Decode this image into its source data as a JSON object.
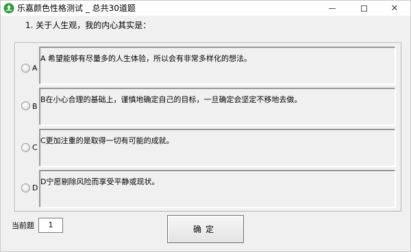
{
  "window": {
    "title": "乐嘉颜色性格测试 _ 总共30道题",
    "close_glyph": "✕"
  },
  "question": {
    "text": "1. 关于人生观，我的内心其实是："
  },
  "options": [
    {
      "letter": "A",
      "text": "A 希望能够有尽量多的人生体验，所以会有非常多样化的想法。"
    },
    {
      "letter": "B",
      "text": "B在小心合理的基础上，谨慎地确定自己的目标，一旦确定会坚定不移地去做。"
    },
    {
      "letter": "C",
      "text": "C更加注重的是取得一切有可能的成就。"
    },
    {
      "letter": "D",
      "text": "D宁愿剔除风险而享受平静或现状。"
    }
  ],
  "footer": {
    "current_label": "当前题",
    "current_value": "1",
    "confirm_label": "确定"
  },
  "colors": {
    "app_icon": "#2e9b3a"
  },
  "icons": {
    "app": "recycle-icon"
  }
}
